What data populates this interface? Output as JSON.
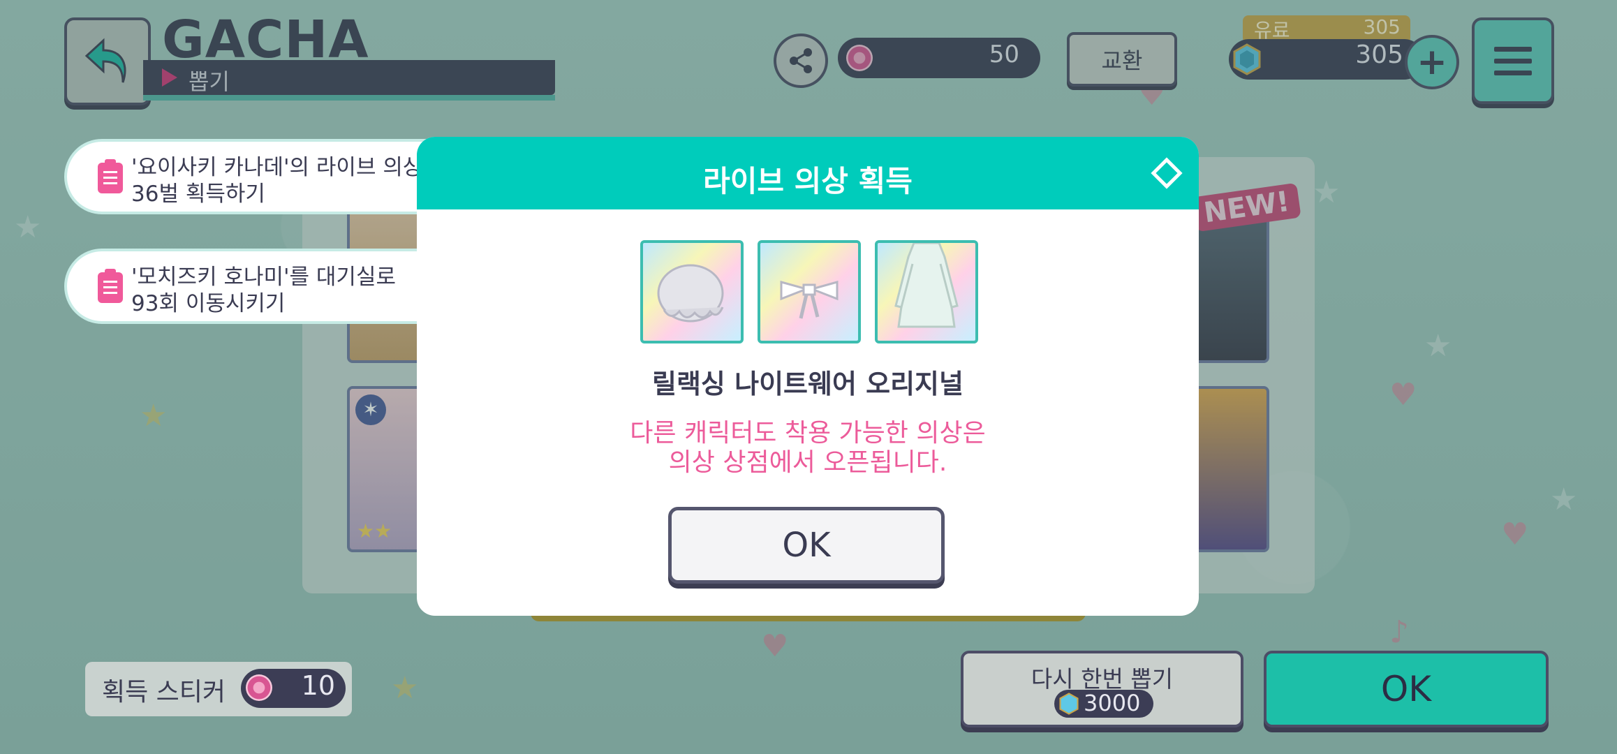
{
  "header": {
    "title": "GACHA",
    "subtitle": "뽑기"
  },
  "currency": {
    "sticker_count": "50",
    "exchange_label": "교환",
    "paid_label": "유료",
    "paid_value": "305",
    "gem_count": "305"
  },
  "missions": [
    {
      "text": "'요이사키 카나데'의 라이브 의상\n36벌 획득하기"
    },
    {
      "text": "'모치즈키 호나미'를 대기실로\n93회 이동시키기"
    }
  ],
  "background": {
    "new_badge": "NEW!"
  },
  "dialog": {
    "title": "라이브 의상 획득",
    "items": [
      "hair-accessory-icon",
      "ribbon-icon",
      "dress-icon"
    ],
    "outfit_name": "릴랙싱 나이트웨어 오리지널",
    "notice": "다른 캐릭터도 착용 가능한 의상은\n의상 상점에서 오픈됩니다.",
    "ok_label": "OK"
  },
  "footer": {
    "obtained_sticker_label": "획득 스티커",
    "obtained_sticker_count": "10",
    "gacha_again_label": "다시 한번 뽑기",
    "gacha_again_cost": "3000",
    "ok_label": "OK"
  },
  "colors": {
    "teal": "#00ccbb",
    "pink_text": "#ec5b9a",
    "navy": "#3a3b52"
  }
}
